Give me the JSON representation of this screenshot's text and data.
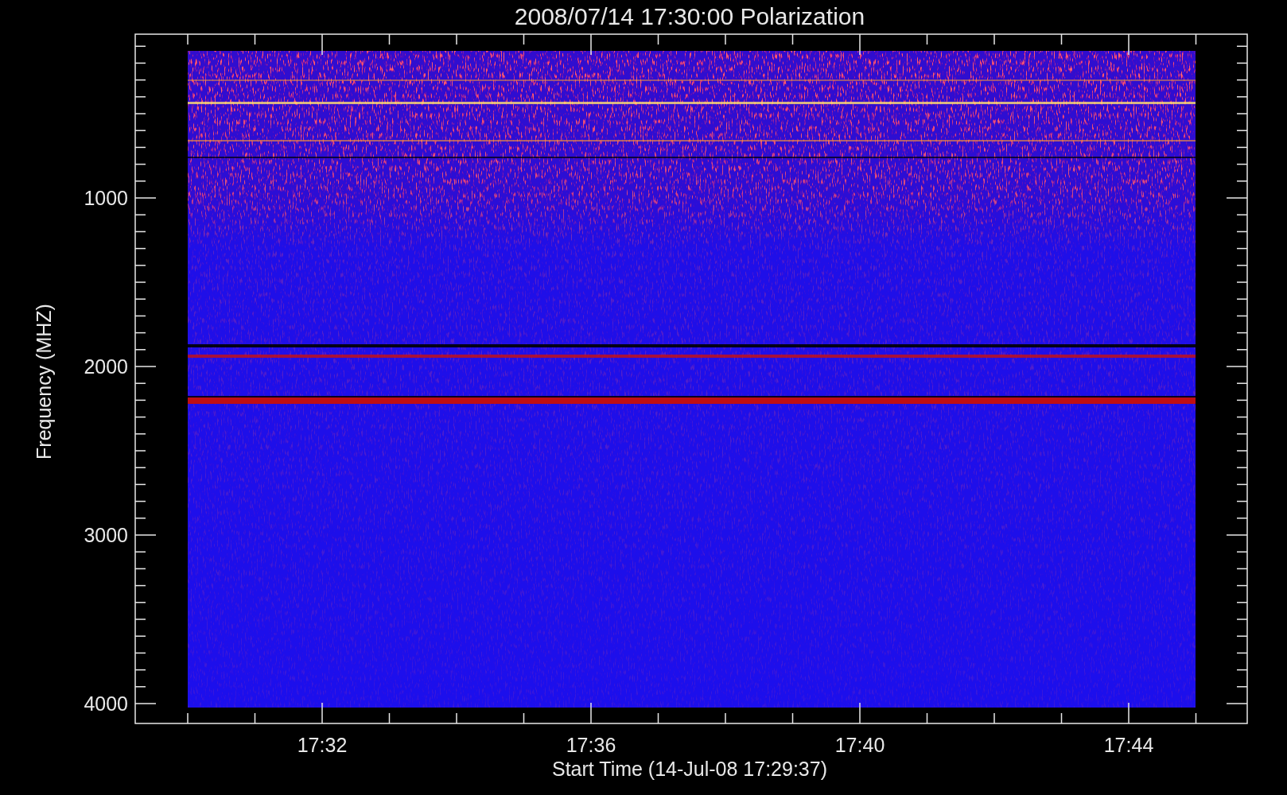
{
  "title": "2008/07/14 17:30:00 Polarization",
  "y_axis": {
    "label": "Frequency (MHZ)",
    "ticks": [
      "1000",
      "2000",
      "3000",
      "4000"
    ]
  },
  "x_axis": {
    "label": "Start Time (14-Jul-08 17:29:37)",
    "ticks": [
      "17:32",
      "17:36",
      "17:40",
      "17:44"
    ]
  }
}
